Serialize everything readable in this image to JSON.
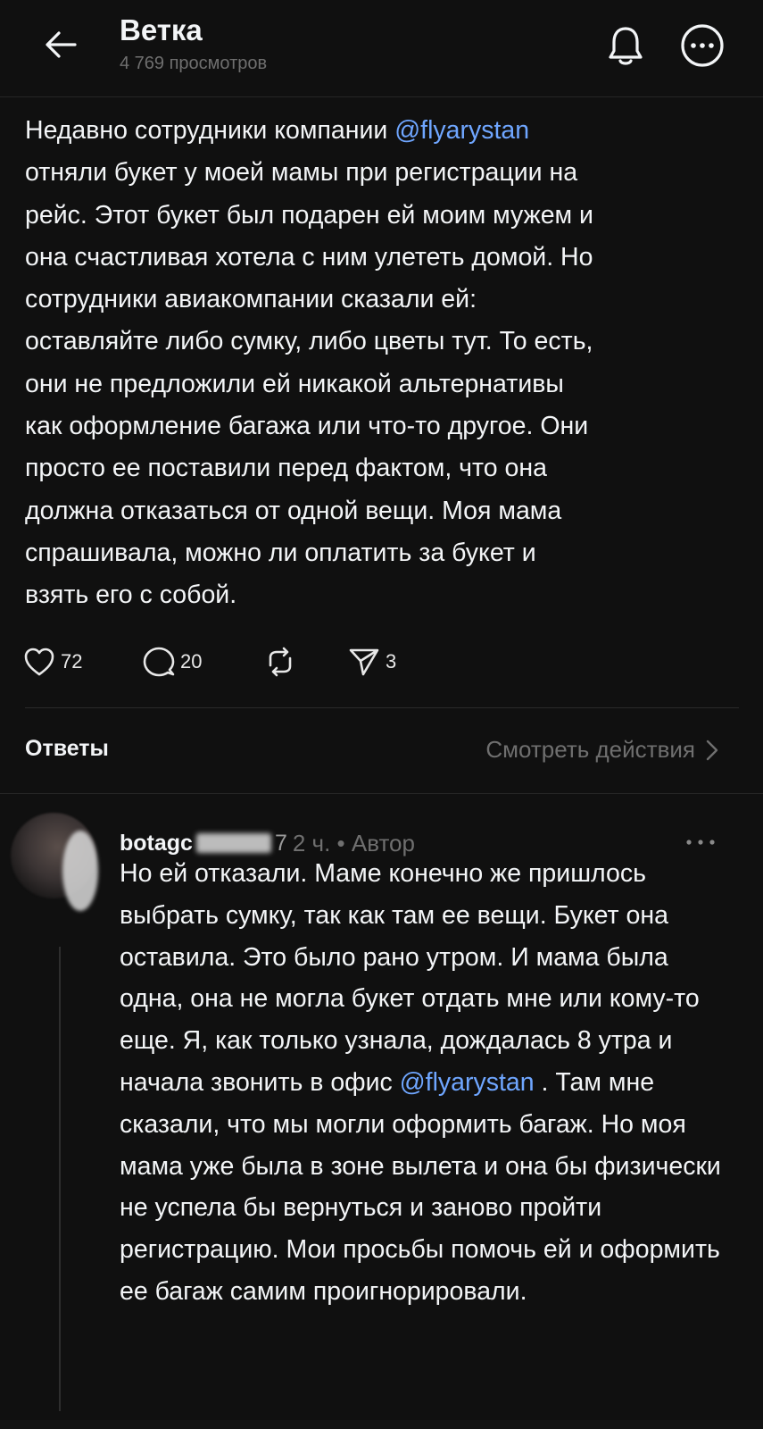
{
  "header": {
    "title": "Ветка",
    "subtitle": "4 769 просмотров"
  },
  "post": {
    "text_before_mention": "Недавно сотрудники компании ",
    "mention": "@flyarystan",
    "text_after_mention": "\nотняли букет у моей мамы при регистрации на\nрейс. Этот букет был подарен ей моим мужем и\nона счастливая хотела с ним улететь домой. Но\nсотрудники авиакомпании сказали ей:\nоставляйте либо сумку, либо цветы тут. То есть,\nони не предложили ей никакой альтернативы\nкак оформление багажа или что-то другое. Они\nпросто ее поставили перед фактом, что она\nдолжна отказаться от одной вещи. Моя мама\nспрашивала, можно ли оплатить за букет и\nвзять его с собой.",
    "likes": "72",
    "replies": "20",
    "shares": "3"
  },
  "replies_section": {
    "label": "Ответы",
    "view_actions": "Смотреть действия"
  },
  "reply": {
    "username": "botagc",
    "username_tail": "7",
    "meta": "2 ч. • Автор",
    "text_before_mention": "Но ей отказали. Маме конечно же пришлось выбрать сумку, так как там ее вещи. Букет она оставила. Это было рано утром. И мама была одна, она не могла букет отдать мне или кому-то еще. Я, как только узнала, дождалась 8 утра и начала звонить в офис ",
    "mention": "@flyarystan",
    "text_after_mention": " . Там мне сказали, что мы могли оформить багаж. Но моя мама уже была в зоне вылета и она бы физически не успела бы вернуться и заново пройти регистрацию. Мои просьбы помочь ей и оформить ее багаж самим проигнорировали."
  },
  "icons": {
    "back": "arrow-left-icon",
    "bell": "bell-icon",
    "more": "more-circle-icon",
    "like": "heart-icon",
    "reply": "comment-icon",
    "repost": "repost-icon",
    "share": "send-icon",
    "chevron": "chevron-right-icon",
    "reply_more": "ellipsis-icon"
  },
  "colors": {
    "background": "#101010",
    "text": "#f3f5f7",
    "muted": "#6f6f6f",
    "mention": "#6fa6ff"
  }
}
